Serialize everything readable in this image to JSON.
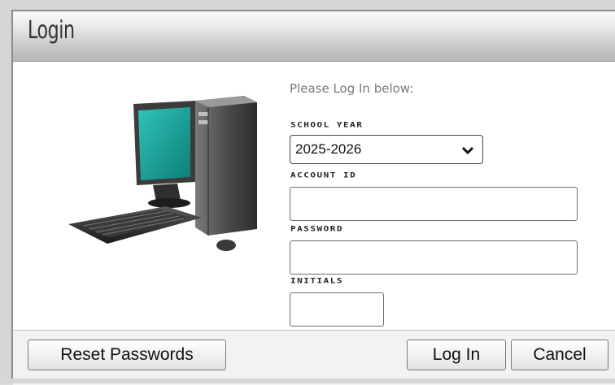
{
  "window": {
    "title": "Login"
  },
  "form": {
    "prompt": "Please Log In below:",
    "school_year": {
      "label": "SCHOOL YEAR",
      "selected": "2025-2026"
    },
    "account_id": {
      "label": "ACCOUNT ID",
      "value": ""
    },
    "password": {
      "label": "PASSWORD",
      "value": ""
    },
    "initials": {
      "label": "INITIALS",
      "value": ""
    }
  },
  "footer": {
    "reset_label": "Reset Passwords",
    "login_label": "Log In",
    "cancel_label": "Cancel"
  },
  "illustration": {
    "icon": "desktop-computer-icon"
  },
  "colors": {
    "prompt_text": "#7a7a7a",
    "monitor_screen": "#1fa39a",
    "title_bar": "#c9c9c9"
  }
}
